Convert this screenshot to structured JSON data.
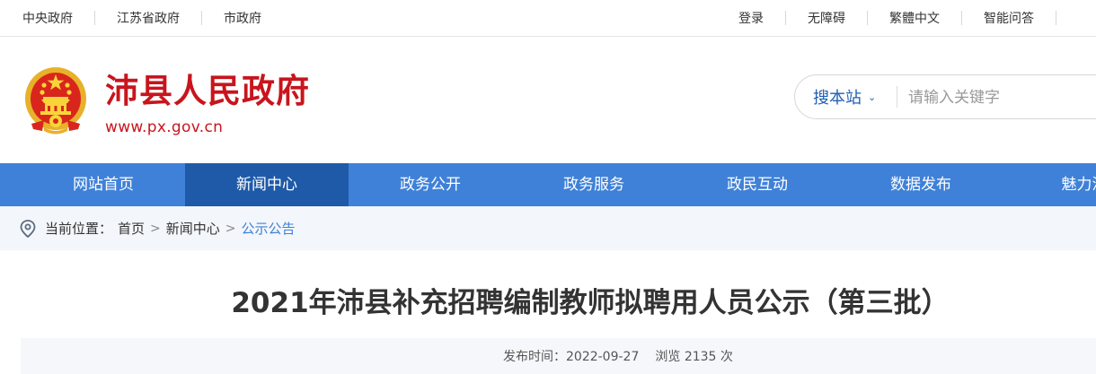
{
  "topbar": {
    "left_links": [
      "中央政府",
      "江苏省政府",
      "市政府"
    ],
    "right_links": [
      "登录",
      "无障碍",
      "繁體中文",
      "智能问答"
    ]
  },
  "header": {
    "title": "沛县人民政府",
    "url": "www.px.gov.cn",
    "emblem_icon": "national-emblem-icon"
  },
  "search": {
    "scope": "搜本站",
    "placeholder": "请输入关键字"
  },
  "nav": {
    "items": [
      "网站首页",
      "新闻中心",
      "政务公开",
      "政务服务",
      "政民互动",
      "数据发布",
      "魅力沛"
    ],
    "active": "新闻中心"
  },
  "breadcrumb": {
    "label": "当前位置：",
    "items": [
      "首页",
      "新闻中心",
      "公示公告"
    ],
    "separator": ">"
  },
  "article": {
    "title": "2021年沛县补充招聘编制教师拟聘用人员公示（第三批）",
    "publish_label": "发布时间：",
    "publish_date": "2022-09-27",
    "views_label": "浏览",
    "views_count": "2135",
    "views_unit": "次"
  },
  "colors": {
    "brand_red": "#c8151d",
    "nav_blue": "#3f81d8",
    "nav_active": "#1e5aa8",
    "link_blue": "#1f5fb5"
  }
}
